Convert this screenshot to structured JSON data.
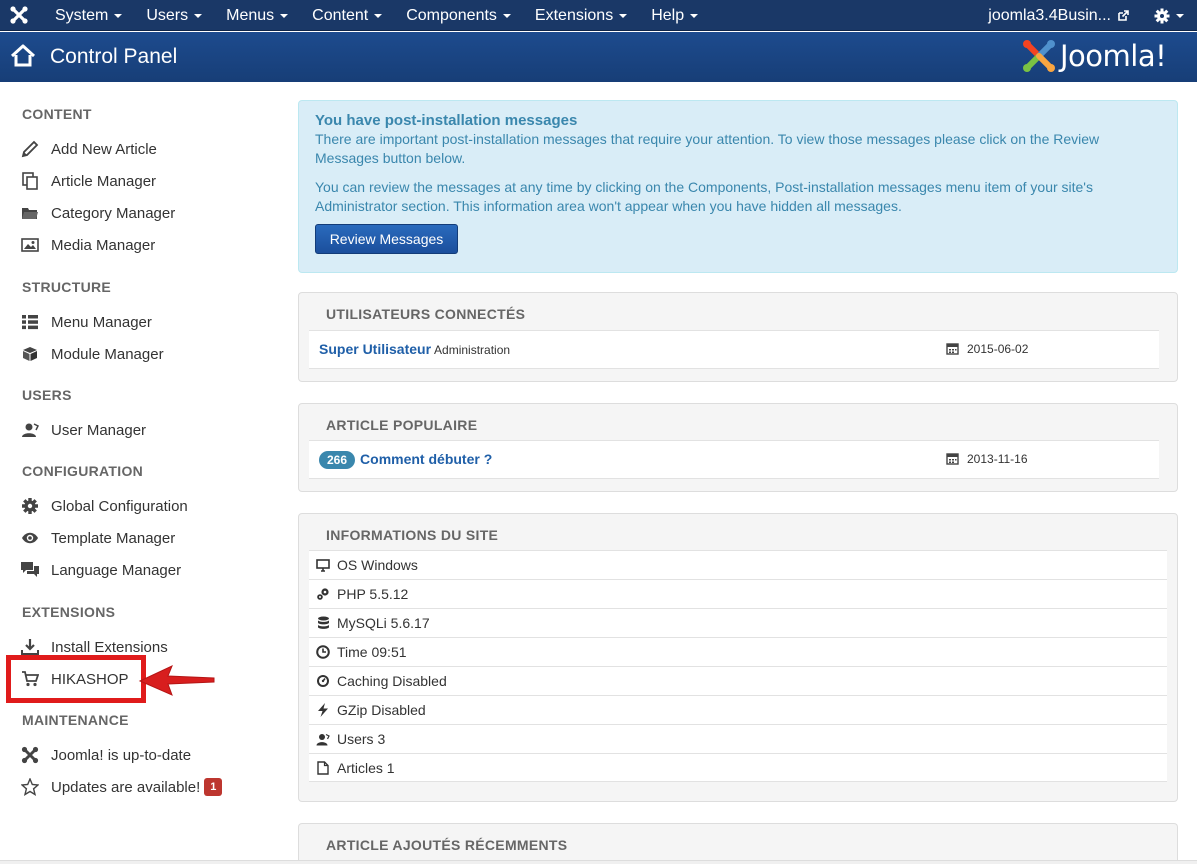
{
  "navbar": {
    "menu": [
      "System",
      "Users",
      "Menus",
      "Content",
      "Components",
      "Extensions",
      "Help"
    ],
    "site_name": "joomla3.4Busin..."
  },
  "header": {
    "title": "Control Panel",
    "logo_text": "Joomla!"
  },
  "sidebar": {
    "content_heading": "CONTENT",
    "add_new_article": "Add New Article",
    "article_manager": "Article Manager",
    "category_manager": "Category Manager",
    "media_manager": "Media Manager",
    "structure_heading": "STRUCTURE",
    "menu_manager": "Menu Manager",
    "module_manager": "Module Manager",
    "users_heading": "USERS",
    "user_manager": "User Manager",
    "configuration_heading": "CONFIGURATION",
    "global_configuration": "Global Configuration",
    "template_manager": "Template Manager",
    "language_manager": "Language Manager",
    "extensions_heading": "EXTENSIONS",
    "install_extensions": "Install Extensions",
    "hikashop": "HIKASHOP",
    "maintenance_heading": "MAINTENANCE",
    "joomla_uptodate": "Joomla! is up-to-date",
    "updates_available": "Updates are available!",
    "updates_count": "1"
  },
  "alert": {
    "title": "You have post-installation messages",
    "p1": "There are important post-installation messages that require your attention. To view those messages please click on the Review Messages button below.",
    "p2": "You can review the messages at any time by clicking on the Components, Post-installation messages menu item of your site's Administrator section. This information area won't appear when you have hidden all messages.",
    "button": "Review Messages"
  },
  "logged_users": {
    "title": "UTILISATEURS CONNECTÉS",
    "user": "Super Utilisateur",
    "area": "Administration",
    "date": "2015-06-02"
  },
  "popular": {
    "title": "ARTICLE POPULAIRE",
    "hits": "266",
    "article": "Comment débuter ?",
    "date": "2013-11-16"
  },
  "site_info": {
    "title": "INFORMATIONS DU SITE",
    "os": "OS Windows",
    "php": "PHP 5.5.12",
    "mysql": "MySQLi 5.6.17",
    "time": "Time 09:51",
    "caching": "Caching Disabled",
    "gzip": "GZip Disabled",
    "users": "Users 3",
    "articles": "Articles 1"
  },
  "recent": {
    "title": "ARTICLE AJOUTÉS RÉCEMMENTS"
  },
  "colors": {
    "navbar": "#1a3867",
    "header": "#1d4b8e",
    "alert_bg": "#d9edf7",
    "highlight": "#e01b1b"
  }
}
